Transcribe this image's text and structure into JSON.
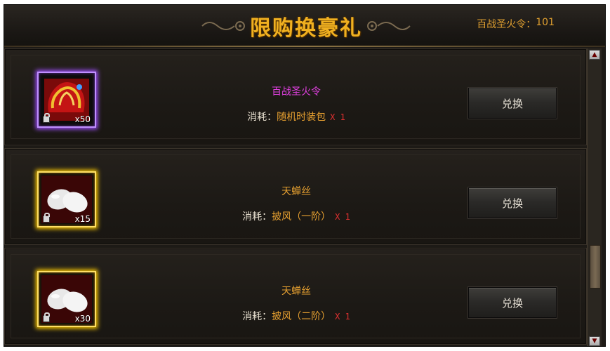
{
  "header": {
    "title": "限购换豪礼",
    "currency_label": "百战圣火令：",
    "currency_value": "101"
  },
  "colors": {
    "title": "#f0b020",
    "item_purple": "#e040e0",
    "item_orange": "#e7a030",
    "multiplier_red": "#e03030"
  },
  "items": [
    {
      "name": "百战圣火令",
      "name_color": "#e040e0",
      "qty": "x50",
      "icon": "flame-token-icon",
      "glow": "purple",
      "cost_label": "消耗：",
      "cost_item": "随机时装包",
      "cost_mult": "X 1",
      "button": "兑换"
    },
    {
      "name": "天蝉丝",
      "name_color": "#e7a030",
      "qty": "x15",
      "icon": "silk-cocoon-icon",
      "glow": "gold",
      "cost_label": "消耗：",
      "cost_item": "披风（一阶）",
      "cost_mult": "X 1",
      "button": "兑换"
    },
    {
      "name": "天蝉丝",
      "name_color": "#e7a030",
      "qty": "x30",
      "icon": "silk-cocoon-icon",
      "glow": "gold",
      "cost_label": "消耗：",
      "cost_item": "披风（二阶）",
      "cost_mult": "X 1",
      "button": "兑换"
    }
  ],
  "scrollbar": {
    "up_icon": "arrow-up-icon",
    "down_icon": "arrow-down-icon"
  }
}
